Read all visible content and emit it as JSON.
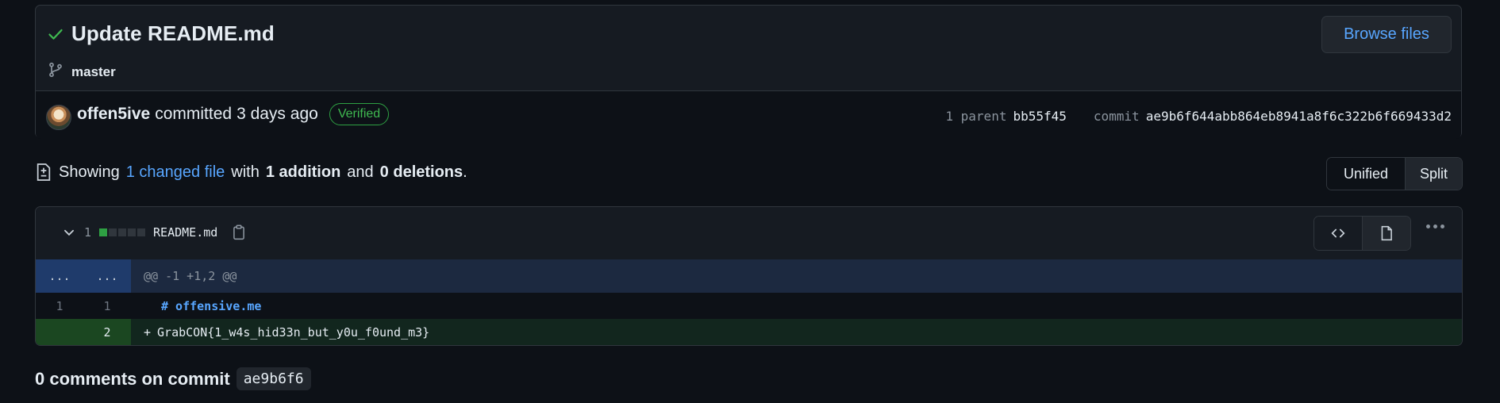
{
  "commit": {
    "title": "Update README.md",
    "branch": "master",
    "browse_label": "Browse files",
    "author": "offen5ive",
    "action": "committed",
    "time": "3 days ago",
    "badge": "Verified",
    "parent_label": "1 parent",
    "parent_sha": "bb55f45",
    "commit_label": "commit",
    "commit_sha": "ae9b6f644abb864eb8941a8f6c322b6f669433d2"
  },
  "summary": {
    "showing": "Showing",
    "changed_link": "1 changed file",
    "with": "with",
    "additions": "1 addition",
    "and": "and",
    "deletions": "0 deletions",
    "period": ".",
    "unified_label": "Unified",
    "split_label": "Split"
  },
  "file": {
    "change_count": "1",
    "name": "README.md",
    "hunk_ln_old": "...",
    "hunk_ln_new": "...",
    "hunk_header": "@@ -1 +1,2 @@",
    "lines": [
      {
        "old": "1",
        "new": "1",
        "marker": "",
        "text": "# offensive.me"
      },
      {
        "old": "",
        "new": "2",
        "marker": "+",
        "text": "GrabCON{1_w4s_hid33n_but_y0u_f0und_m3}"
      }
    ]
  },
  "comments": {
    "label": "0 comments on commit",
    "sha": "ae9b6f6"
  },
  "colors": {
    "background": "#0d1117",
    "accent": "#58a6ff",
    "success": "#3fb950",
    "addition_bg": "#12261e"
  },
  "icons": [
    "check-icon",
    "git-branch-icon",
    "diff-icon",
    "chevron-down-icon",
    "clipboard-icon",
    "code-icon",
    "file-icon",
    "kebab-icon"
  ]
}
